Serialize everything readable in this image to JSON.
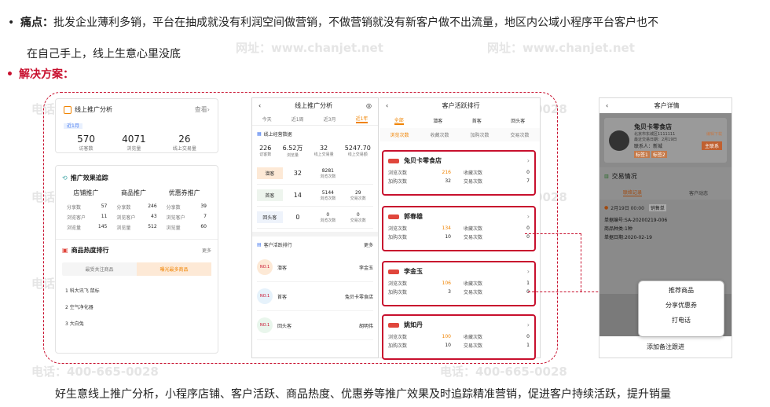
{
  "pain": {
    "label": "痛点：",
    "text1": "批发企业薄利多销，平台在抽成就没有利润空间做营销，不做营销就没有新客户做不出流量，地区内公域小程序平台客户也不",
    "text2": "在自己手上，线上生意心里没底"
  },
  "solution": {
    "label": "解决方案："
  },
  "footer": "好生意线上推广分析，小程序店铺、客户活跃、商品热度、优惠券等推广效果及时追踪精准营销，促进客户持续活跃，提升销量",
  "watermarks": {
    "site": "网址：www.chanjet.net",
    "phone": "电话：400-665-0028"
  },
  "panel1": {
    "title": "线上推广分析",
    "link": "查看",
    "period": "近1月",
    "stats": [
      {
        "value": "570",
        "label": "访客数"
      },
      {
        "value": "4071",
        "label": "浏览量"
      },
      {
        "value": "26",
        "label": "线上交易量"
      }
    ],
    "effect_title": "推广效果追踪",
    "cols": [
      "店铺推广",
      "商品推广",
      "优惠券推广"
    ],
    "rows": [
      [
        [
          "分享数",
          "57"
        ],
        [
          "分享数",
          "246"
        ],
        [
          "分享数",
          "39"
        ]
      ],
      [
        [
          "浏览客户",
          "11"
        ],
        [
          "浏览客户",
          "43"
        ],
        [
          "浏览客户",
          "7"
        ]
      ],
      [
        [
          "浏览量",
          "145"
        ],
        [
          "浏览量",
          "512"
        ],
        [
          "浏览量",
          "60"
        ]
      ]
    ],
    "rank_title": "商品热度排行",
    "rank_more": "更多",
    "tabs": [
      "最受关注商品",
      "曝光最多商品"
    ],
    "items": [
      "1  科大讯飞 鼠标",
      "2  空气净化器",
      "3  大白兔"
    ]
  },
  "panel2": {
    "title": "线上推广分析",
    "tabs": [
      "今天",
      "近1周",
      "近3月",
      "近1年"
    ],
    "biz_title": "线上经营数据",
    "stats": [
      {
        "v": "226",
        "l": "访客数"
      },
      {
        "v": "6.52万",
        "l": "浏览量"
      },
      {
        "v": "32",
        "l": "线上交易量"
      },
      {
        "v": "5247.70",
        "l": "线上交易额"
      }
    ],
    "groups": [
      {
        "name": "潜客",
        "a": "32",
        "b": "8281",
        "bl": "浏览次数",
        "c": "",
        "cl": ""
      },
      {
        "name": "首客",
        "a": "14",
        "b": "5144",
        "bl": "浏览次数",
        "c": "29",
        "cl": "交易次数"
      },
      {
        "name": "回头客",
        "a": "0",
        "b": "0",
        "bl": "浏览次数",
        "c": "0",
        "cl": "交易次数"
      }
    ],
    "rank_title": "客户活跃排行",
    "rank_more": "更多",
    "ranks": [
      {
        "no": "NO.1",
        "type": "潜客",
        "name": "李金玉"
      },
      {
        "no": "NO.1",
        "type": "首客",
        "name": "兔贝卡零食店"
      },
      {
        "no": "NO.1",
        "type": "回头客",
        "name": "胡明伟"
      }
    ]
  },
  "panel3": {
    "title": "客户活跃排行",
    "tabs": [
      "全部",
      "潜客",
      "首客",
      "回头客"
    ],
    "sorts": [
      "浏览次数",
      "收藏次数",
      "加购次数",
      "交易次数"
    ],
    "customers": [
      {
        "name": "兔贝卡零食店",
        "browse": "216",
        "fav": "0",
        "cart": "32",
        "trade": "7"
      },
      {
        "name": "郭春雄",
        "browse": "134",
        "fav": "0",
        "cart": "10",
        "trade": "0"
      },
      {
        "name": "李金玉",
        "browse": "106",
        "fav": "1",
        "cart": "3",
        "trade": "0"
      },
      {
        "name": "姚如丹",
        "browse": "100",
        "fav": "0",
        "cart": "10",
        "trade": "1"
      }
    ],
    "labels": {
      "browse": "浏览次数",
      "fav": "收藏次数",
      "cart": "加购次数",
      "trade": "交易次数"
    }
  },
  "panel4": {
    "title": "客户详情",
    "store": "兔贝卡零食店",
    "addr": "北京市东城区1111111",
    "date": "最近交易日期：2月19日",
    "contact": "联系人：新城",
    "tag1": "标签1",
    "tag2": "标签2",
    "edit": "编辑下载",
    "btn": "主联系",
    "trade_title": "交易情况",
    "tabs": [
      "联络记录",
      "客户动态"
    ],
    "record_date": "2月19日 00:00",
    "record_tag": "销售单",
    "record_lines": [
      "单据编号:SA-20200219-006",
      "商品种类:1种",
      "单据日期:2020-02-19"
    ],
    "menu": [
      "推荐商品",
      "分享优惠券",
      "打电话"
    ],
    "bottom": "添加备注跟进"
  }
}
